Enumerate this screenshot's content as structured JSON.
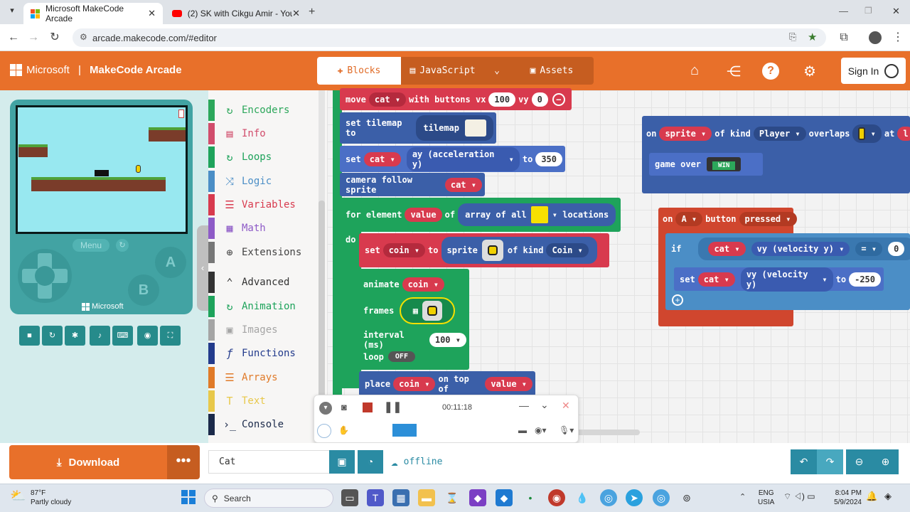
{
  "browser": {
    "tabs": [
      {
        "title": "Microsoft MakeCode Arcade"
      },
      {
        "title": "(2) SK with Cikgu Amir - YouTu"
      }
    ],
    "url": "arcade.makecode.com/#editor"
  },
  "header": {
    "brand_ms": "Microsoft",
    "brand_app": "MakeCode Arcade",
    "modes": [
      "Blocks",
      "JavaScript",
      "Assets"
    ],
    "active_mode": "Blocks",
    "sign_in": "Sign In"
  },
  "simulator": {
    "menu_label": "Menu",
    "btn_a": "A",
    "btn_b": "B",
    "brand": "Microsoft"
  },
  "toolbox": {
    "categories": [
      {
        "label": "Encoders",
        "color": "#2ca75b"
      },
      {
        "label": "Info",
        "color": "#d14d6c"
      },
      {
        "label": "Loops",
        "color": "#1ea35b"
      },
      {
        "label": "Logic",
        "color": "#4b8ec6"
      },
      {
        "label": "Variables",
        "color": "#d83a4e"
      },
      {
        "label": "Math",
        "color": "#8e5bc7"
      },
      {
        "label": "Extensions",
        "color": "#777777"
      },
      {
        "label": "Advanced",
        "color": "#333333"
      },
      {
        "label": "Animation",
        "color": "#1ea35b"
      },
      {
        "label": "Images",
        "color": "#a5a5a5"
      },
      {
        "label": "Functions",
        "color": "#233b8c"
      },
      {
        "label": "Arrays",
        "color": "#e07a28"
      },
      {
        "label": "Text",
        "color": "#e8c84a"
      },
      {
        "label": "Console",
        "color": "#1b2a4a"
      }
    ]
  },
  "blocks": {
    "move": {
      "t1": "move",
      "sprite": "cat",
      "t2": "with buttons vx",
      "vx": "100",
      "t3": "vy",
      "vy": "0"
    },
    "tilemap": {
      "t1": "set tilemap to",
      "t2": "tilemap"
    },
    "set_ay": {
      "t1": "set",
      "sprite": "cat",
      "prop": "ay (acceleration y)",
      "t2": "to",
      "val": "350"
    },
    "camera": {
      "t1": "camera follow sprite",
      "sprite": "cat"
    },
    "for_element": {
      "t1": "for element",
      "var": "value",
      "t2": "of",
      "t3": "array of all",
      "t4": "locations",
      "do": "do"
    },
    "set_coin": {
      "t1": "set",
      "var": "coin",
      "t2": "to",
      "t3": "sprite",
      "t4": "of kind",
      "kind": "Coin"
    },
    "animate": {
      "t1": "animate",
      "var": "coin",
      "frames": "frames",
      "interval": "interval (ms)",
      "interval_val": "100",
      "loop": "loop",
      "loop_val": "OFF"
    },
    "place": {
      "t1": "place",
      "var": "coin",
      "t2": "on top of",
      "t3": "value"
    },
    "overlap": {
      "t1": "on",
      "sprite": "sprite",
      "t2": "of kind",
      "kind": "Player",
      "t3": "overlaps",
      "t4": "at",
      "t5": "l",
      "game_over": "game over",
      "win": "WIN"
    },
    "button": {
      "t1": "on",
      "btn": "A",
      "t2": "button",
      "event": "pressed",
      "if": "if",
      "sprite": "cat",
      "prop": "vy (velocity y)",
      "op": "=",
      "cmp": "0",
      "set": "set",
      "to": "to",
      "val": "-250"
    }
  },
  "recorder": {
    "time": "00:11:18"
  },
  "bottom": {
    "download": "Download",
    "project_name": "Cat",
    "status": "offline"
  },
  "taskbar": {
    "temp": "87°F",
    "weather": "Partly cloudy",
    "search": "Search",
    "lang1": "ENG",
    "lang2": "USIA",
    "time": "8:04 PM",
    "date": "5/9/2024"
  }
}
